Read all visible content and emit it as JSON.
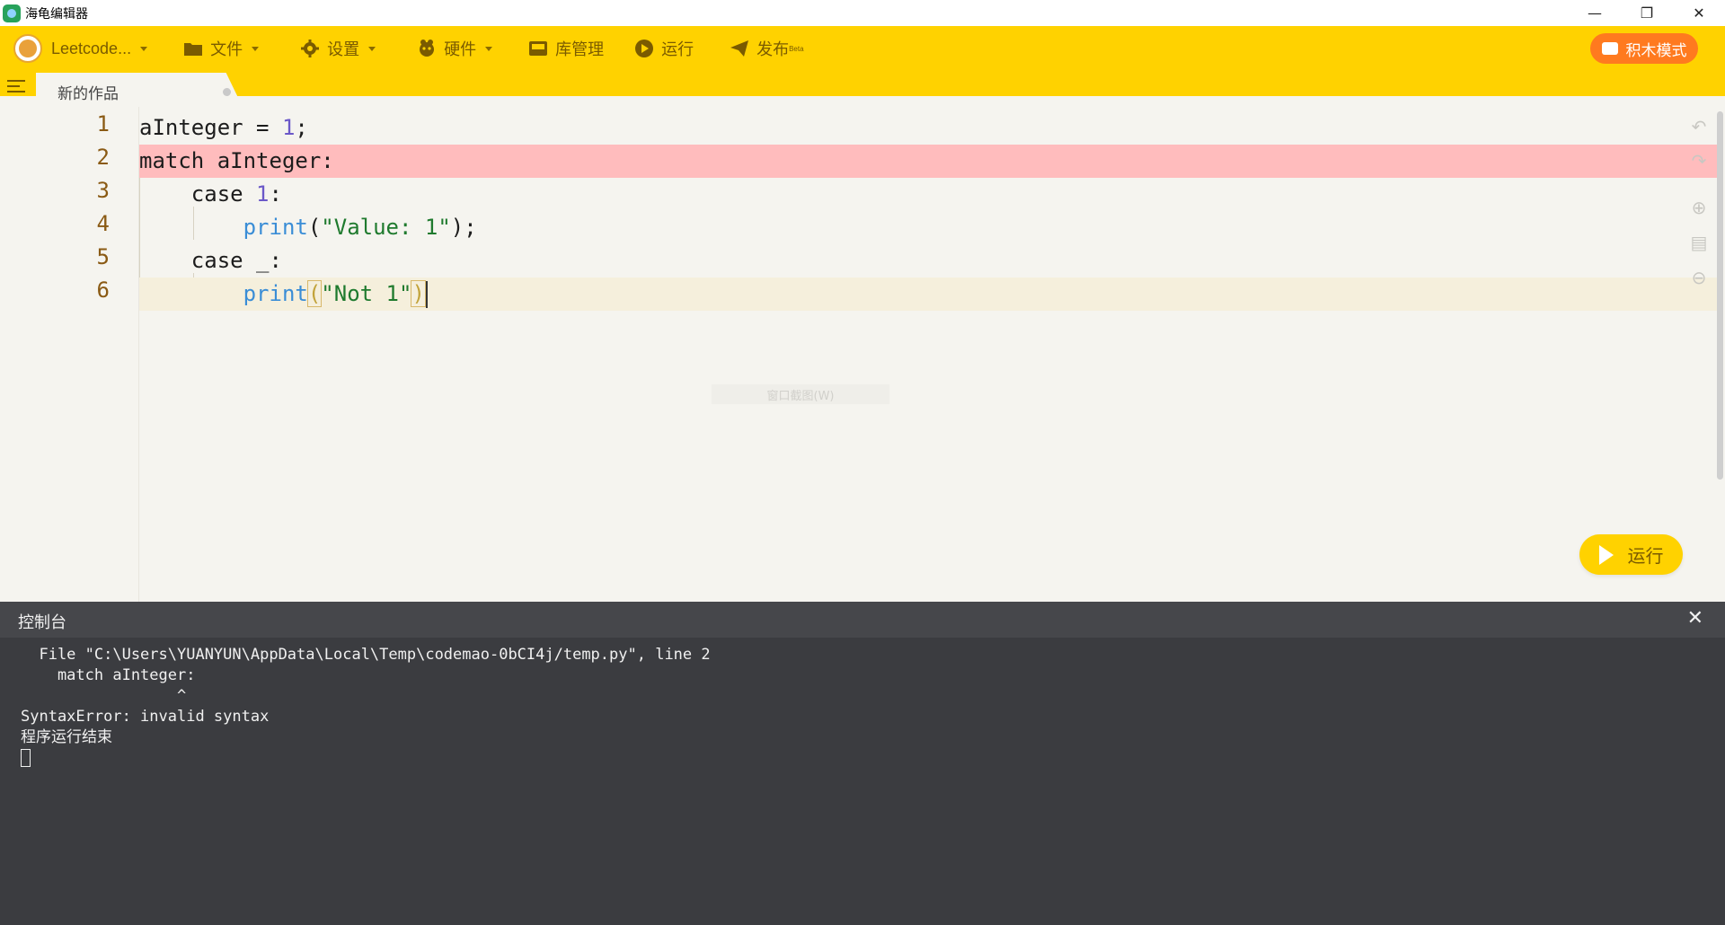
{
  "window": {
    "title": "海龟编辑器",
    "controls": {
      "minimize": "—",
      "restore": "❐",
      "close": "✕"
    }
  },
  "toolbar": {
    "project_name": "Leetcode...",
    "menus": [
      {
        "label": "文件",
        "icon": "folder-icon"
      },
      {
        "label": "设置",
        "icon": "gear-icon"
      },
      {
        "label": "硬件",
        "icon": "hardware-icon"
      },
      {
        "label": "库管理",
        "icon": "library-icon"
      },
      {
        "label": "运行",
        "icon": "play-circle-icon"
      },
      {
        "label": "发布",
        "icon": "paper-plane-icon",
        "badge": "Beta"
      }
    ],
    "block_mode_label": "积木模式",
    "accent_color": "#ffd200",
    "block_mode_color": "#ff7a1f"
  },
  "tab": {
    "label": "新的作品"
  },
  "editor": {
    "line_numbers": [
      "1",
      "2",
      "3",
      "4",
      "5",
      "6"
    ],
    "lines": [
      {
        "parts": [
          {
            "t": "aInteger = "
          },
          {
            "t": "1",
            "c": "num"
          },
          {
            "t": ";"
          }
        ]
      },
      {
        "parts": [
          {
            "t": "match aInteger:"
          }
        ]
      },
      {
        "parts": [
          {
            "t": "    case "
          },
          {
            "t": "1",
            "c": "num"
          },
          {
            "t": ":"
          }
        ]
      },
      {
        "parts": [
          {
            "t": "        "
          },
          {
            "t": "print",
            "c": "fn"
          },
          {
            "t": "("
          },
          {
            "t": "\"Value: 1\"",
            "c": "str"
          },
          {
            "t": ");"
          }
        ]
      },
      {
        "parts": [
          {
            "t": "    case _:"
          }
        ]
      },
      {
        "parts": [
          {
            "t": "        "
          },
          {
            "t": "print",
            "c": "fn"
          },
          {
            "t": "(",
            "c": "bracket-match"
          },
          {
            "t": "\"Not 1\"",
            "c": "str"
          },
          {
            "t": ")",
            "c": "bracket-match"
          }
        ]
      }
    ],
    "error_line": 2,
    "current_line": 6,
    "error_color": "#ffbcbd",
    "ghost_tip": "窗口截图(W)"
  },
  "run_button": {
    "label": "运行"
  },
  "console": {
    "title": "控制台",
    "close": "✕",
    "output": [
      "  File \"C:\\Users\\YUANYUN\\AppData\\Local\\Temp\\codemao-0bCI4j/temp.py\", line 2",
      "    match aInteger:",
      "                 ^",
      "SyntaxError: invalid syntax",
      "程序运行结束"
    ]
  }
}
